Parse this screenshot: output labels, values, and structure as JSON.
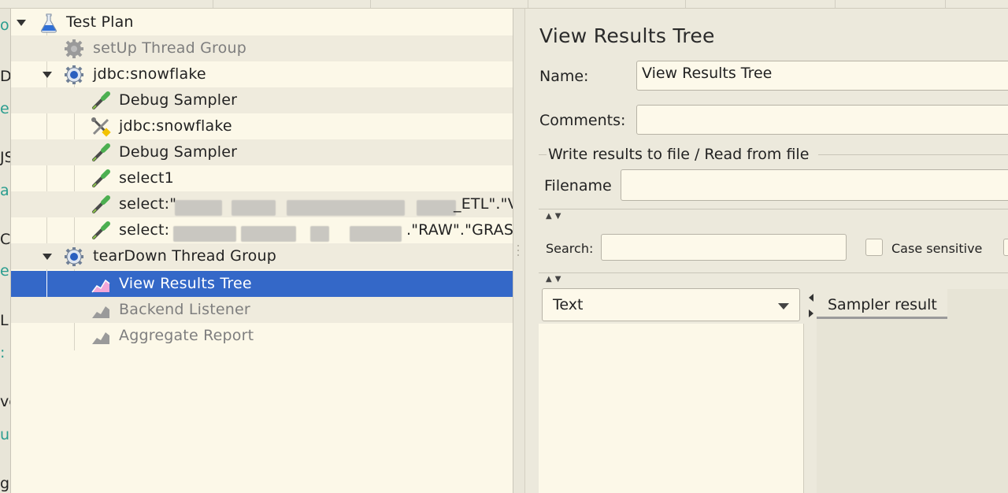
{
  "tree": {
    "items": [
      {
        "label": "Test Plan"
      },
      {
        "label": "setUp Thread Group"
      },
      {
        "label": "jdbc:snowflake"
      },
      {
        "label": "Debug Sampler"
      },
      {
        "label": "jdbc:snowflake"
      },
      {
        "label": "Debug Sampler"
      },
      {
        "label": "select1"
      },
      {
        "label": "select:\""
      },
      {
        "label": "_ETL\".\"V"
      },
      {
        "label": "select:"
      },
      {
        "label": ".\"RAW\".\"GRAS_"
      },
      {
        "label": "tearDown Thread Group"
      },
      {
        "label": "View Results Tree"
      },
      {
        "label": "Backend Listener"
      },
      {
        "label": "Aggregate Report"
      }
    ],
    "selected": "View Results Tree"
  },
  "panel": {
    "title": "View Results Tree",
    "name_label": "Name:",
    "name_value": "View Results Tree",
    "comments_label": "Comments:",
    "comments_value": "",
    "file_group_label": "Write results to file / Read from file",
    "filename_label": "Filename",
    "filename_value": "",
    "search_label": "Search:",
    "search_value": "",
    "case_sensitive_label": "Case sensitive",
    "renderer_selected": "Text",
    "result_tab_label": "Sampler result"
  },
  "left_edge_fragments": [
    "o",
    "D",
    "e",
    "JS",
    "a",
    "C",
    "er",
    "L",
    ":",
    "ve",
    "u:",
    "g"
  ],
  "colors": {
    "selection": "#3468c8",
    "tree_bg": "#fcf8e8",
    "panel_bg": "#ece9dc"
  },
  "icons": [
    "flask-icon",
    "gear-icon",
    "thread-group-icon",
    "dropper-icon",
    "tools-icon",
    "graph-icon"
  ]
}
